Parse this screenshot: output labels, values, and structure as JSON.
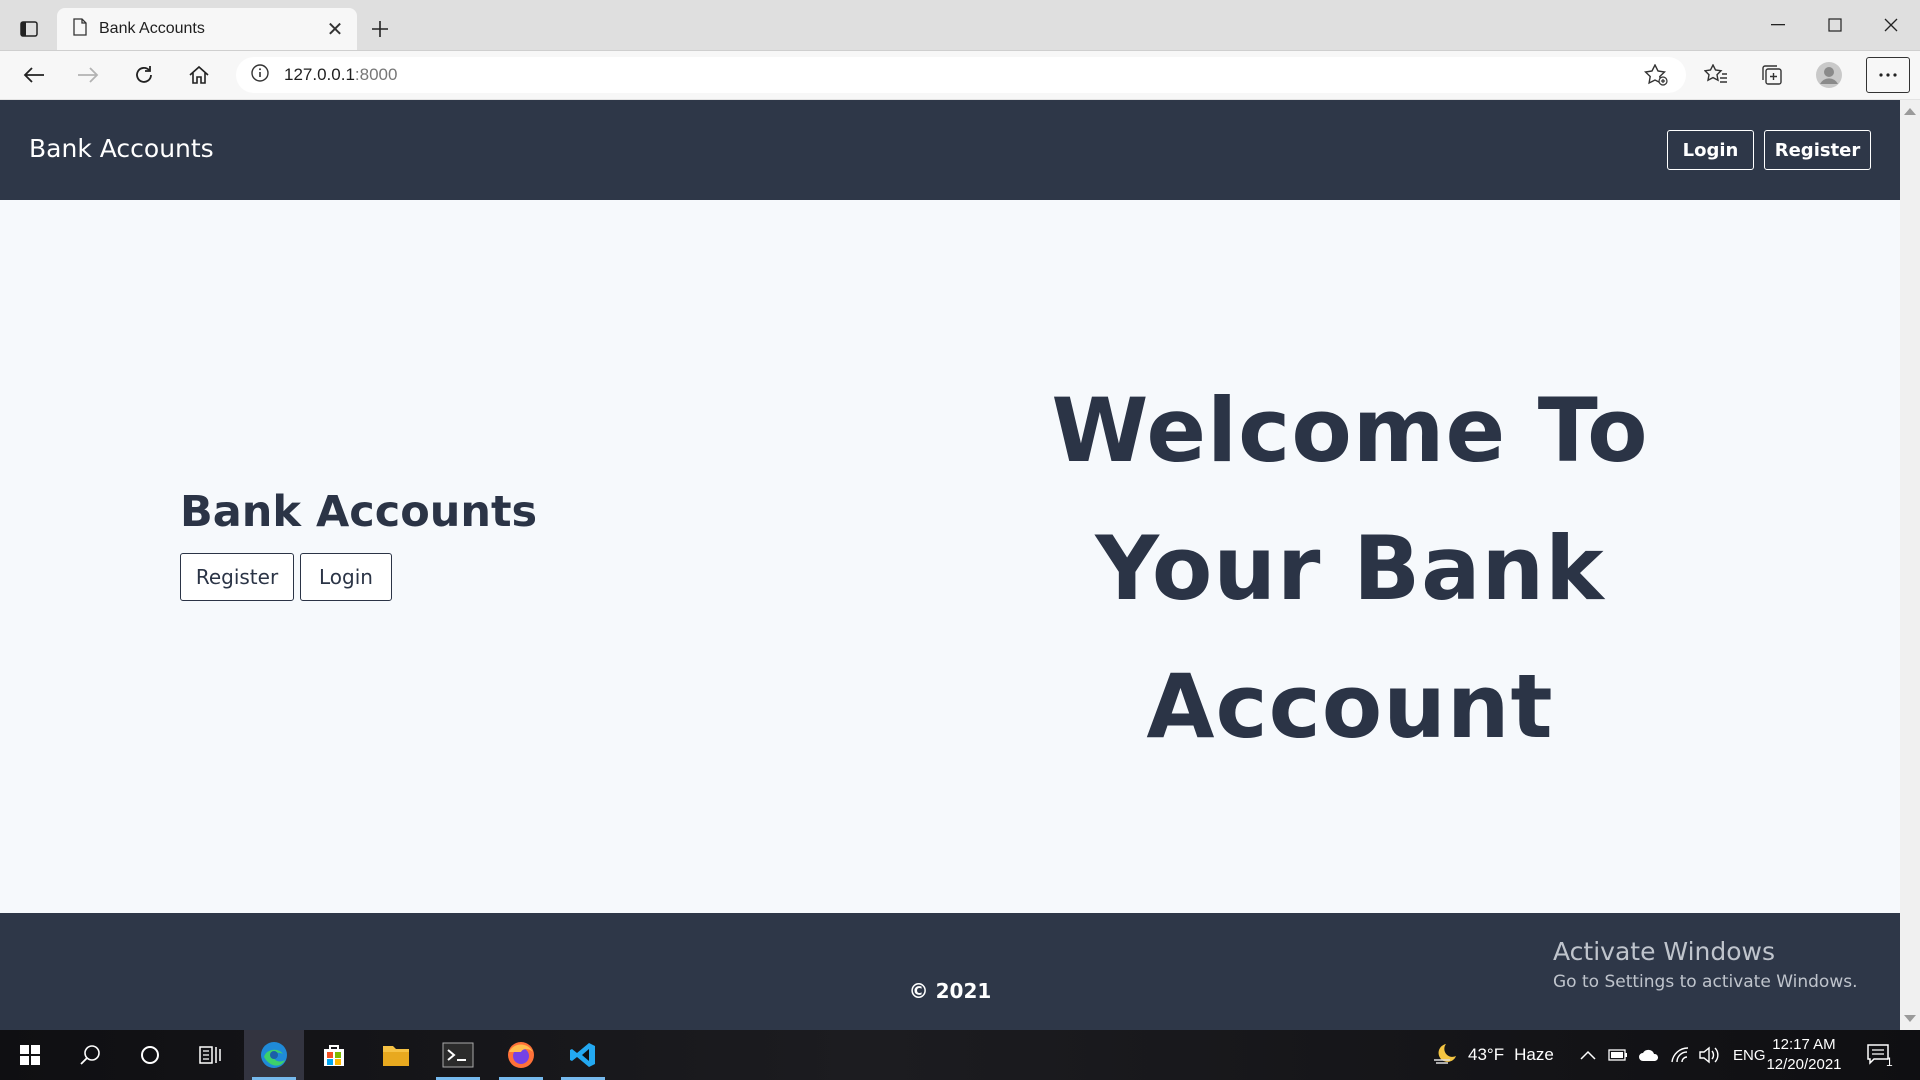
{
  "browser": {
    "tab_title": "Bank Accounts",
    "url_host": "127.0.0.1",
    "url_port": ":8000"
  },
  "site": {
    "brand": "Bank Accounts",
    "header_login": "Login",
    "header_register": "Register",
    "hero_title": "Bank Accounts",
    "hero_register": "Register",
    "hero_login": "Login",
    "welcome_line1": "Welcome To",
    "welcome_line2": "Your Bank",
    "welcome_line3": "Account",
    "copyright": "© 2021"
  },
  "watermark": {
    "title": "Activate Windows",
    "subtitle": "Go to Settings to activate Windows."
  },
  "taskbar": {
    "weather_temp": "43°F",
    "weather_desc": "Haze",
    "language": "ENG",
    "time": "12:17 AM",
    "date": "12/20/2021",
    "notification_count": "1"
  },
  "colors": {
    "header_bg": "#2e3748",
    "page_bg": "#f6f9fc",
    "text_dark": "#2b3446"
  }
}
